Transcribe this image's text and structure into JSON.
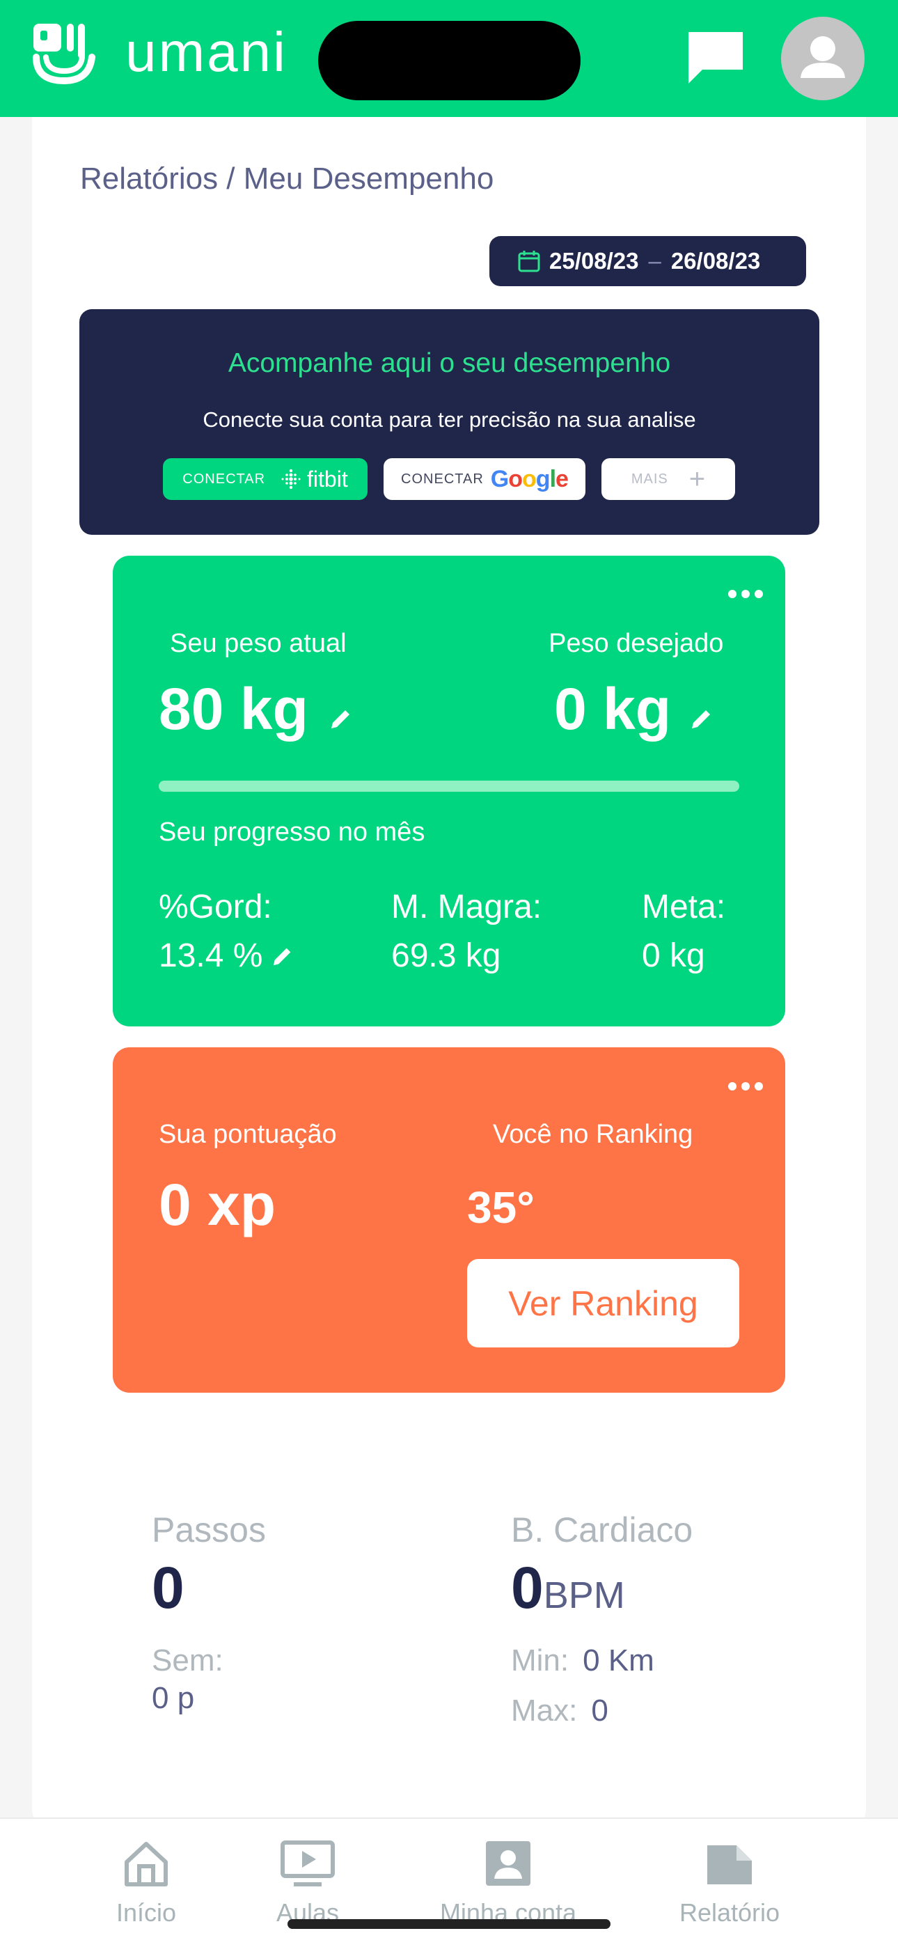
{
  "header": {
    "app_name": "umani",
    "brand_color": "#00d680"
  },
  "breadcrumb": "Relatórios / Meu Desempenho",
  "date_range": {
    "start": "25/08/23",
    "separator": "–",
    "end": "26/08/23"
  },
  "connect": {
    "title": "Acompanhe aqui o seu desempenho",
    "subtitle": "Conecte sua conta para ter precisão na sua analise",
    "fitbit_prefix": "CONECTAR",
    "fitbit_brand": "fitbit",
    "google_prefix": "CONECTAR",
    "google_brand": "Google",
    "more_label": "MAIS",
    "more_plus": "+"
  },
  "weight": {
    "current_label": "Seu peso atual",
    "current_value": "80 kg",
    "desired_label": "Peso desejado",
    "desired_value": "0 kg",
    "progress_label": "Seu progresso no mês",
    "progress_fraction": 0,
    "fat_label": "%Gord:",
    "fat_value": "13.4 %",
    "lean_label": "M. Magra:",
    "lean_value": "69.3 kg",
    "goal_label": "Meta:",
    "goal_value": "0 kg"
  },
  "score": {
    "points_label": "Sua pontuação",
    "points_value": "0 xp",
    "ranking_label": "Você no Ranking",
    "ranking_value": "35°",
    "ranking_button": "Ver Ranking",
    "accent_color": "#ff7446"
  },
  "steps": {
    "label": "Passos",
    "value": "0",
    "week_label": "Sem:",
    "week_value": "0 p"
  },
  "heart": {
    "label": "B. Cardiaco",
    "value": "0",
    "unit": "BPM",
    "min_label": "Min:",
    "min_value": "0 Km",
    "max_label": "Max:",
    "max_value": "0"
  },
  "nav": {
    "home": "Início",
    "classes": "Aulas",
    "account": "Minha conta",
    "report": "Relatório"
  }
}
